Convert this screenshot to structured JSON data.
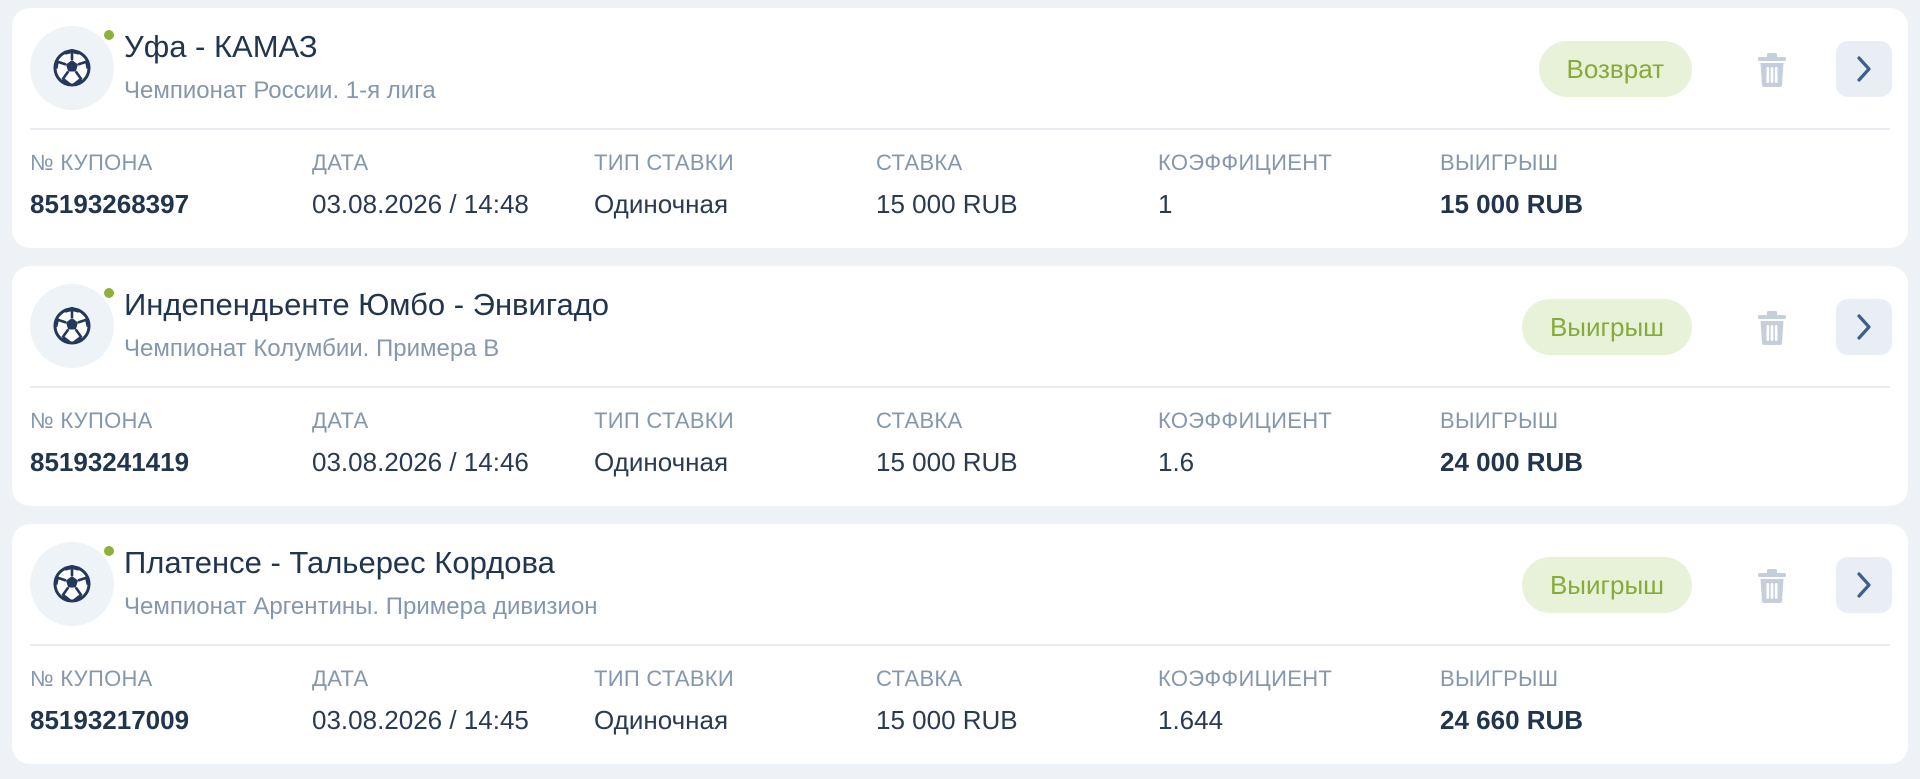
{
  "labels": {
    "coupon": "№ КУПОНА",
    "date": "ДАТА",
    "bet_type": "ТИП СТАВКИ",
    "stake": "СТАВКА",
    "coefficient": "КОЭФФИЦИЕНТ",
    "winnings": "ВЫИГРЫШ"
  },
  "icons": {
    "sport": "soccer-ball-icon",
    "live": "live-dot-icon",
    "delete": "trash-icon",
    "open": "chevron-right-icon"
  },
  "colors": {
    "badge_bg": "#e8f2d8",
    "badge_text": "#86ab3a",
    "live_dot": "#8fb13b"
  },
  "bets": [
    {
      "match": "Уфа - КАМАЗ",
      "league": "Чемпионат России. 1-я лига",
      "status": "Возврат",
      "coupon": "85193268397",
      "date": "03.08.2026 / 14:48",
      "bet_type": "Одиночная",
      "stake": "15 000 RUB",
      "coefficient": "1",
      "winnings": "15 000 RUB"
    },
    {
      "match": "Индепендьенте Юмбо - Энвигадо",
      "league": "Чемпионат Колумбии. Примера B",
      "status": "Выигрыш",
      "coupon": "85193241419",
      "date": "03.08.2026 / 14:46",
      "bet_type": "Одиночная",
      "stake": "15 000 RUB",
      "coefficient": "1.6",
      "winnings": "24 000 RUB"
    },
    {
      "match": "Платенсе - Тальерес Кордова",
      "league": "Чемпионат Аргентины. Примера дивизион",
      "status": "Выигрыш",
      "coupon": "85193217009",
      "date": "03.08.2026 / 14:45",
      "bet_type": "Одиночная",
      "stake": "15 000 RUB",
      "coefficient": "1.644",
      "winnings": "24 660 RUB"
    }
  ]
}
